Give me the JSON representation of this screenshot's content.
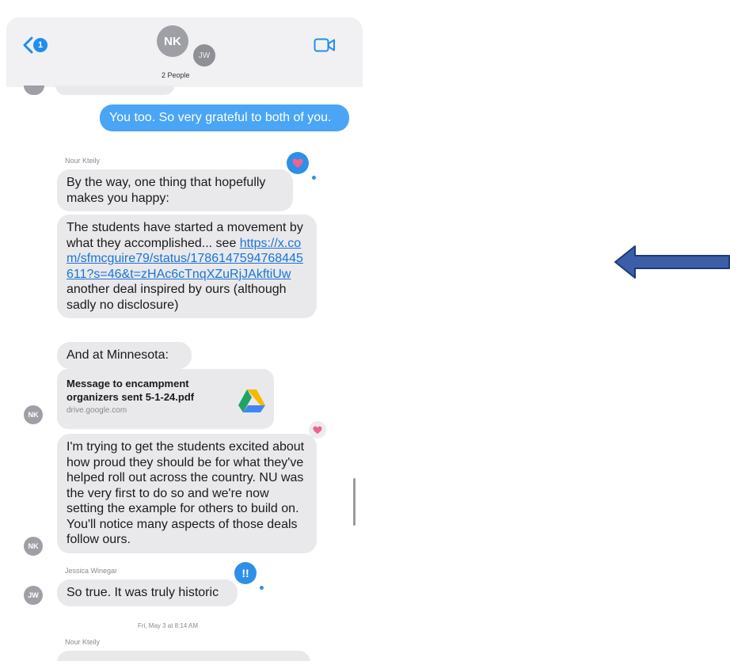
{
  "header": {
    "back_count": "1",
    "avatar_main": "NK",
    "avatar_secondary": "JW",
    "people_label": "2 People",
    "icons": {
      "back": "chevron-left-icon",
      "video": "video-camera-icon"
    }
  },
  "messages": {
    "outgoing_1": "You too.  So very grateful to both of you.",
    "sender_1": "Nour Kteily",
    "msg_1": "By the way, one thing that hopefully makes you happy:",
    "msg_2_pre": "The students have started a movement by what they accomplished... see ",
    "msg_2_link": "https://x.com/sfmcguire79/status/1786147594768445611?s=46&t=zHAc6cTnqXZuRjJAkftiUw",
    "msg_2_post": " another deal inspired by ours (although sadly no disclosure)",
    "msg_3": "And at Minnesota:",
    "attachment_name": "Message to encampment organizers sent 5-1-24.pdf",
    "attachment_domain": "drive.google.com",
    "avatar_nk_1": "NK",
    "msg_4": "I'm trying to get the students excited about how proud they should be for what they've helped roll out across the country. NU was the very first to do so and we're now setting the example for others to build on. You'll notice many aspects of those deals follow ours.",
    "avatar_nk_2": "NK",
    "sender_2": "Jessica Winegar",
    "msg_5": "So true. It was truly historic",
    "avatar_jw": "JW",
    "timestamp": "Fri, May 3 at 8:14 AM",
    "sender_3": "Nour Kteily",
    "tapback_emphasis": "!!"
  },
  "colors": {
    "outgoing_bubble": "#4aa5f6",
    "incoming_bubble": "#e9e9eb",
    "link": "#1b74d8",
    "arrow_fill": "#3a5fa8"
  }
}
